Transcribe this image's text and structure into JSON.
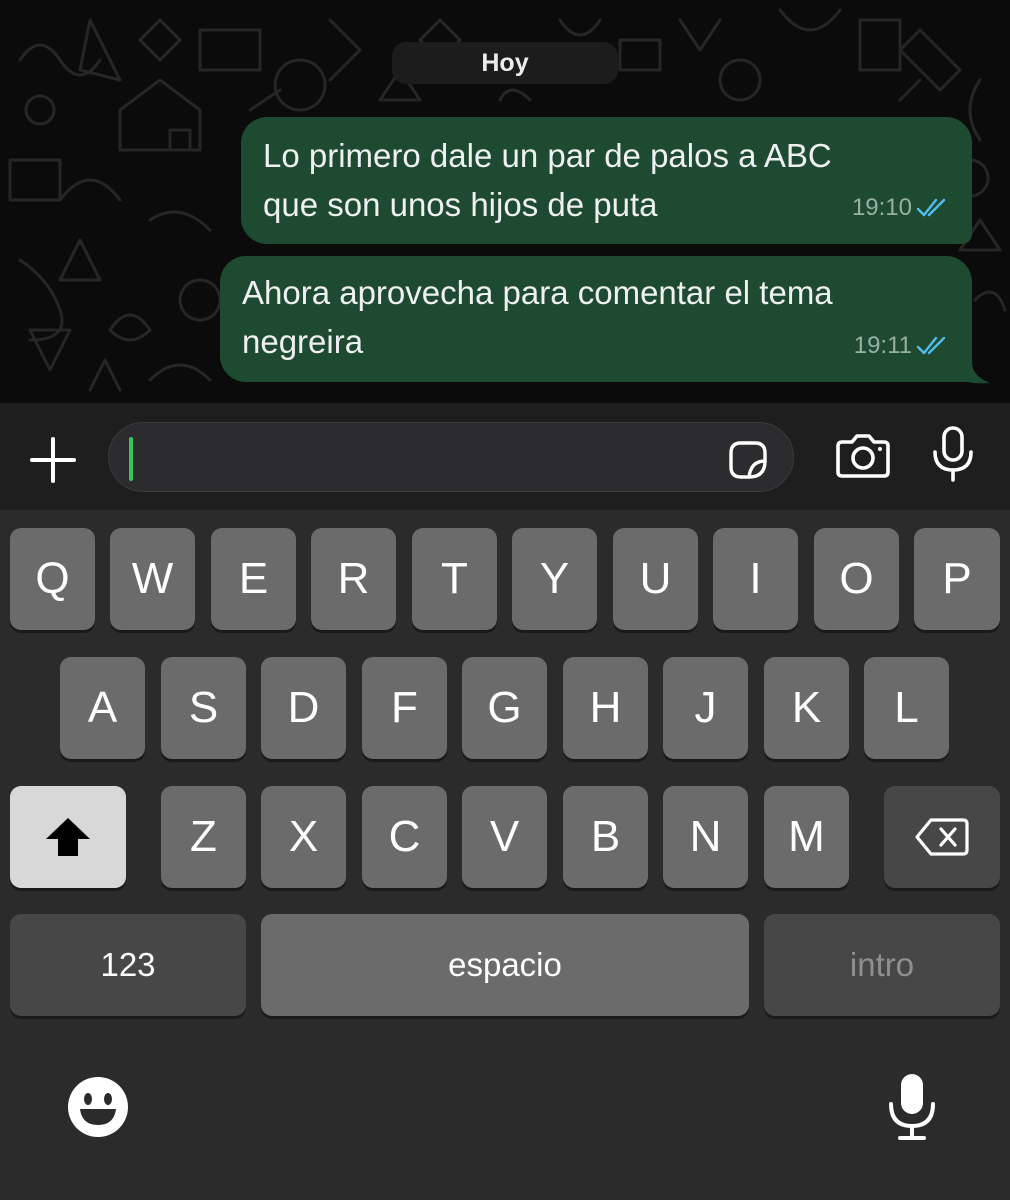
{
  "chat": {
    "date_label": "Hoy",
    "messages": [
      {
        "lines": [
          "Lo primero dale un par de palos a ABC",
          "que son unos hijos de puta"
        ],
        "time": "19:10",
        "status": "read"
      },
      {
        "lines": [
          "Ahora aprovecha para comentar el tema",
          "negreira"
        ],
        "time": "19:11",
        "status": "read"
      }
    ]
  },
  "input": {
    "value": "",
    "icons": [
      "plus-icon",
      "sticker-icon",
      "camera-icon",
      "microphone-icon"
    ]
  },
  "keyboard": {
    "row1": [
      "Q",
      "W",
      "E",
      "R",
      "T",
      "Y",
      "U",
      "I",
      "O",
      "P"
    ],
    "row2": [
      "A",
      "S",
      "D",
      "F",
      "G",
      "H",
      "J",
      "K",
      "L"
    ],
    "row3": [
      "Z",
      "X",
      "C",
      "V",
      "B",
      "N",
      "M"
    ],
    "numbers_label": "123",
    "space_label": "espacio",
    "return_label": "intro",
    "icons": [
      "shift-icon",
      "backspace-icon",
      "emoji-icon",
      "dictation-icon"
    ]
  },
  "colors": {
    "bubble": "#1e4a32",
    "read_ticks": "#53bdeb",
    "caret": "#31c860",
    "key": "#6b6b6b",
    "keyboard_bg": "#2b2b2b"
  }
}
